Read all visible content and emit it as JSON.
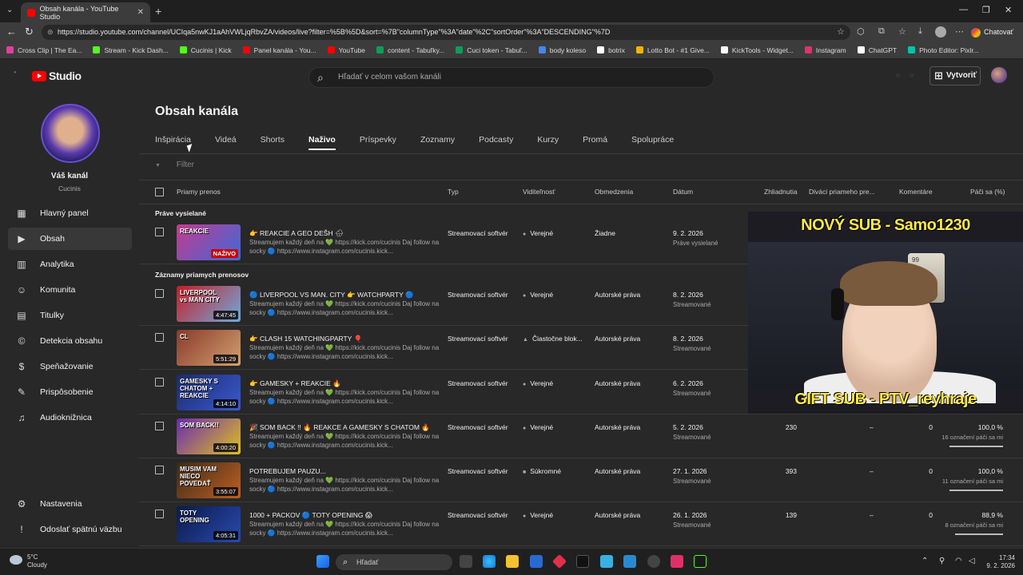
{
  "browser": {
    "tab_title": "Obsah kanála - YouTube Studio",
    "url": "https://studio.youtube.com/channel/UCIqa5nwKJ1aAhVWLjqRbvZA/videos/live?filter=%5B%5D&sort=%7B\"columnType\"%3A\"date\"%2C\"sortOrder\"%3A\"DESCENDING\"%7D",
    "chat_label": "Chatovať",
    "bookmarks": [
      {
        "label": "Cross Clip | The Ea...",
        "color": "#e040a0"
      },
      {
        "label": "Stream - Kick Dash...",
        "color": "#53fc18"
      },
      {
        "label": "Cucinis | Kick",
        "color": "#53fc18"
      },
      {
        "label": "Panel kanála - You...",
        "color": "#ff0000"
      },
      {
        "label": "YouTube",
        "color": "#ff0000"
      },
      {
        "label": "content - Tabuľky...",
        "color": "#0f9d58"
      },
      {
        "label": "Cuci token - Tabuľ...",
        "color": "#0f9d58"
      },
      {
        "label": "body koleso",
        "color": "#4285f4"
      },
      {
        "label": "botrix",
        "color": "#ffffff"
      },
      {
        "label": "Lotto Bot - #1 Give...",
        "color": "#f4b400"
      },
      {
        "label": "KickTools - Widget...",
        "color": "#ffffff"
      },
      {
        "label": "Instagram",
        "color": "#e1306c"
      },
      {
        "label": "ChatGPT",
        "color": "#ffffff"
      },
      {
        "label": "Photo Editor: Pixlr...",
        "color": "#00c2a8"
      }
    ]
  },
  "header": {
    "logo_text": "Studio",
    "search_placeholder": "Hľadať v celom vašom kanáli",
    "create_label": "Vytvoriť"
  },
  "sidebar": {
    "channel_title": "Váš kanál",
    "channel_name": "Cucinis",
    "items": [
      {
        "label": "Hlavný panel",
        "icon": "dashboard-icon",
        "glyph": "▦"
      },
      {
        "label": "Obsah",
        "icon": "content-icon",
        "glyph": "▶"
      },
      {
        "label": "Analytika",
        "icon": "analytics-icon",
        "glyph": "▥"
      },
      {
        "label": "Komunita",
        "icon": "community-icon",
        "glyph": "☺"
      },
      {
        "label": "Titulky",
        "icon": "subtitles-icon",
        "glyph": "▤"
      },
      {
        "label": "Detekcia obsahu",
        "icon": "copyright-icon",
        "glyph": "©"
      },
      {
        "label": "Speňažovanie",
        "icon": "monetization-icon",
        "glyph": "$"
      },
      {
        "label": "Prispôsobenie",
        "icon": "customization-icon",
        "glyph": "✎"
      },
      {
        "label": "Audioknižnica",
        "icon": "audio-library-icon",
        "glyph": "♫"
      }
    ],
    "bottom_items": [
      {
        "label": "Nastavenia",
        "icon": "settings-icon",
        "glyph": "⚙"
      },
      {
        "label": "Odoslať spätnú väzbu",
        "icon": "feedback-icon",
        "glyph": "!"
      }
    ]
  },
  "main": {
    "title": "Obsah kanála",
    "tabs": [
      "Inšpirácia",
      "Videá",
      "Shorts",
      "Naživo",
      "Príspevky",
      "Zoznamy",
      "Podcasty",
      "Kurzy",
      "Promá",
      "Spolupráce"
    ],
    "active_tab": "Naživo",
    "filter_placeholder": "Filter",
    "columns": {
      "stream": "Priamy prenos",
      "type": "Typ",
      "visibility": "Viditeľnosť",
      "restrictions": "Obmedzenia",
      "date": "Dátum",
      "views": "Zhliadnutia",
      "live_viewers": "Diváci priameho pre...",
      "comments": "Komentáre",
      "likes": "Páči sa (%)"
    },
    "group_live": "Práve vysielané",
    "group_recorded": "Záznamy priamych prenosov",
    "rows": [
      {
        "title": "👉 REAKCIE A GEO DEŠH 🌧",
        "desc": "Streamujem každý deň na 💚 https://kick.com/cucinis Daj follow na socky 🔵 https://www.instagram.com/cucinis.kick...",
        "type": "Streamovací softvér",
        "visibility": "Verejné",
        "restrictions": "Žiadne",
        "date": "9. 2. 2026",
        "date_sub": "Práve vysielané",
        "badge": "NAŽIVO",
        "thumb_text": "REAKCIE",
        "thumb_colors": [
          "#c43a8f",
          "#3b6bd8"
        ],
        "views": "",
        "live_viewers": "",
        "comments": "",
        "likes": "",
        "likes_sub": "",
        "like_ratio": null
      },
      {
        "title": "🔵 LIVERPOOL VS MAN. CITY 👉 WATCHPARTY 🔵",
        "desc": "Streamujem každý deň na 💚 https://kick.com/cucinis Daj follow na socky 🔵 https://www.instagram.com/cucinis.kick...",
        "type": "Streamovací softvér",
        "visibility": "Verejné",
        "restrictions": "Autorské práva",
        "date": "8. 2. 2026",
        "date_sub": "Streamované",
        "badge": "4:47:45",
        "thumb_text": "LIVERPOOL vs MAN CITY",
        "thumb_colors": [
          "#c81d25",
          "#6cabdd"
        ],
        "views": "",
        "live_viewers": "",
        "comments": "",
        "likes": "",
        "likes_sub": "",
        "like_ratio": null
      },
      {
        "title": "👉 CLASH 15 WATCHINGPARTY 🎈",
        "desc": "Streamujem každý deň na 💚 https://kick.com/cucinis Daj follow na socky 🔵 https://www.instagram.com/cucinis.kick...",
        "type": "Streamovací softvér",
        "visibility": "Čiastočne blok...",
        "restrictions": "Autorské práva",
        "date": "8. 2. 2026",
        "date_sub": "Streamované",
        "badge": "5:51:29",
        "thumb_text": "CL",
        "thumb_colors": [
          "#8a3a2a",
          "#d2a070"
        ],
        "views": "",
        "live_viewers": "",
        "comments": "",
        "likes": "",
        "likes_sub": "",
        "like_ratio": null
      },
      {
        "title": "👉 GAMESKY + REAKCIE 🔥",
        "desc": "Streamujem každý deň na 💚 https://kick.com/cucinis Daj follow na socky 🔵 https://www.instagram.com/cucinis.kick...",
        "type": "Streamovací softvér",
        "visibility": "Verejné",
        "restrictions": "Autorské práva",
        "date": "6. 2. 2026",
        "date_sub": "Streamované",
        "badge": "4:14:10",
        "thumb_text": "GAMESKY S CHATOM + REAKCIE",
        "thumb_colors": [
          "#1a2a6a",
          "#3a5ad0"
        ],
        "views": "",
        "live_viewers": "",
        "comments": "",
        "likes": "",
        "likes_sub": "",
        "like_ratio": null
      },
      {
        "title": "🎉 SOM BACK !! 🔥 REAKCE A GAMESKY S CHATOM 🔥",
        "desc": "Streamujem každý deň na 💚 https://kick.com/cucinis Daj follow na socky 🔵 https://www.instagram.com/cucinis.kick...",
        "type": "Streamovací softvér",
        "visibility": "Verejné",
        "restrictions": "Autorské práva",
        "date": "5. 2. 2026",
        "date_sub": "Streamované",
        "badge": "4:00:20",
        "thumb_text": "SOM BACK!!",
        "thumb_colors": [
          "#6a2ab0",
          "#e0c020"
        ],
        "views": "230",
        "live_viewers": "–",
        "comments": "0",
        "likes": "100,0 %",
        "likes_sub": "16 označení páči sa mi",
        "like_ratio": 1.0
      },
      {
        "title": "POTREBUJEM PAUZU...",
        "desc": "Streamujem každý deň na 💚 https://kick.com/cucinis Daj follow na socky 🔵 https://www.instagram.com/cucinis.kick...",
        "type": "Streamovací softvér",
        "visibility": "Súkromné",
        "restrictions": "Autorské práva",
        "date": "27. 1. 2026",
        "date_sub": "Streamované",
        "badge": "3:55:07",
        "thumb_text": "MUSIM VAM NIECO POVEDAŤ",
        "thumb_colors": [
          "#3a2a1a",
          "#c06020"
        ],
        "views": "393",
        "live_viewers": "–",
        "comments": "0",
        "likes": "100,0 %",
        "likes_sub": "11 označení páči sa mi",
        "like_ratio": 1.0
      },
      {
        "title": "1000 + PACKOV 🔵 TOTY OPENING 😱",
        "desc": "Streamujem každý deň na 💚 https://kick.com/cucinis Daj follow na socky 🔵 https://www.instagram.com/cucinis.kick...",
        "type": "Streamovací softvér",
        "visibility": "Verejné",
        "restrictions": "Autorské práva",
        "date": "26. 1. 2026",
        "date_sub": "Streamované",
        "badge": "4:05:31",
        "thumb_text": "TOTY OPENING",
        "thumb_colors": [
          "#0a1a4a",
          "#2a4ab0"
        ],
        "views": "139",
        "live_viewers": "–",
        "comments": "0",
        "likes": "88,9 %",
        "likes_sub": "8 označení páči sa mi",
        "like_ratio": 0.889
      }
    ]
  },
  "overlay": {
    "top_text": "NOVÝ SUB - Samo1230",
    "bottom_text": "GIFT SUB - PTV_reyhraje",
    "card_rating": "99"
  },
  "taskbar": {
    "temp": "5°C",
    "weather": "Cloudy",
    "search_label": "Hľadať",
    "time": "17:34",
    "date": "9. 2. 2026"
  }
}
